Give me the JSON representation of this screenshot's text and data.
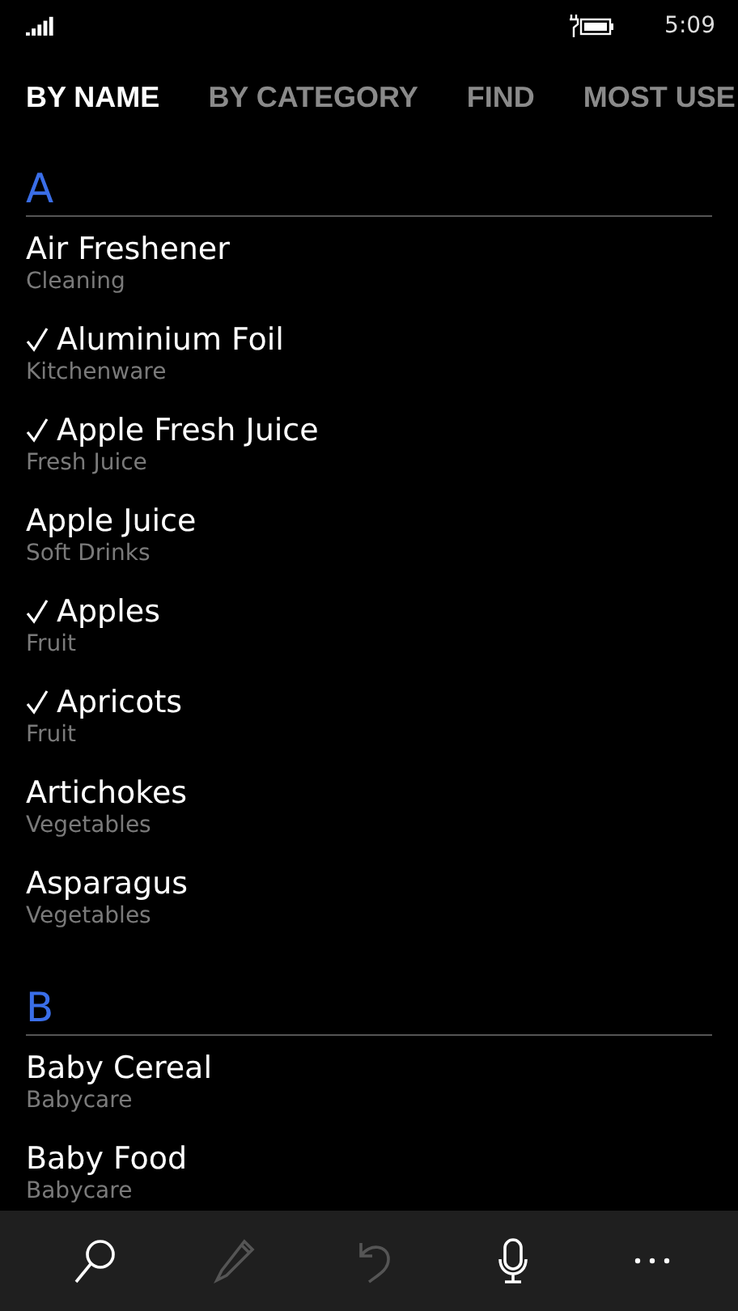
{
  "status_bar": {
    "time": "5:09",
    "charging": true
  },
  "tabs": [
    {
      "label": "BY NAME",
      "selected": true
    },
    {
      "label": "BY CATEGORY",
      "selected": false
    },
    {
      "label": "FIND",
      "selected": false
    },
    {
      "label": "MOST USE",
      "selected": false
    }
  ],
  "groups": [
    {
      "letter": "A",
      "items": [
        {
          "name": "Air Freshener",
          "category": "Cleaning",
          "checked": false
        },
        {
          "name": "Aluminium Foil",
          "category": "Kitchenware",
          "checked": true
        },
        {
          "name": "Apple Fresh Juice",
          "category": "Fresh Juice",
          "checked": true
        },
        {
          "name": "Apple Juice",
          "category": "Soft Drinks",
          "checked": false
        },
        {
          "name": "Apples",
          "category": "Fruit",
          "checked": true
        },
        {
          "name": "Apricots",
          "category": "Fruit",
          "checked": true
        },
        {
          "name": "Artichokes",
          "category": "Vegetables",
          "checked": false
        },
        {
          "name": "Asparagus",
          "category": "Vegetables",
          "checked": false
        }
      ]
    },
    {
      "letter": "B",
      "items": [
        {
          "name": "Baby Cereal",
          "category": "Babycare",
          "checked": false
        },
        {
          "name": "Baby Food",
          "category": "Babycare",
          "checked": false
        }
      ]
    }
  ],
  "app_bar": [
    {
      "kind": "search",
      "disabled": false
    },
    {
      "kind": "edit",
      "disabled": true
    },
    {
      "kind": "undo",
      "disabled": true
    },
    {
      "kind": "microphone",
      "disabled": false
    },
    {
      "kind": "more",
      "disabled": false
    }
  ]
}
